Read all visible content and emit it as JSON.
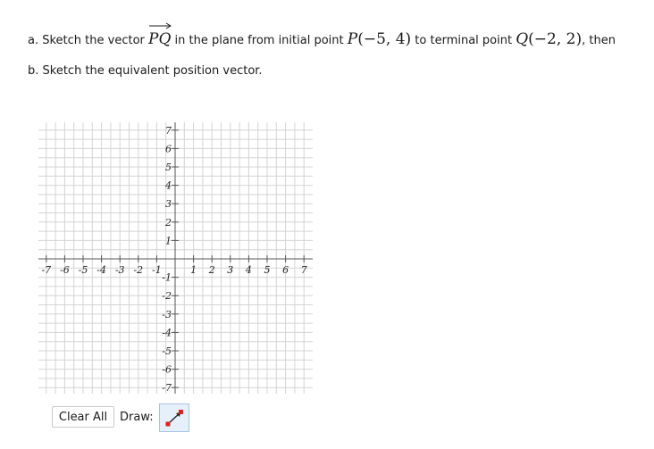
{
  "problem": {
    "part_a": {
      "prefix": "a. Sketch the vector ",
      "vector_from": "P",
      "vector_to": "Q",
      "mid1": " in the plane from initial point ",
      "p_label": "P",
      "p_coords": "(−5, 4)",
      "mid2": " to terminal point ",
      "q_label": "Q",
      "q_coords": "(−2, 2)",
      "suffix": ", then"
    },
    "part_b": "b. Sketch the equivalent position vector."
  },
  "graph": {
    "x_ticks": [
      "-7",
      "-6",
      "-5",
      "-4",
      "-3",
      "-2",
      "-1",
      "1",
      "2",
      "3",
      "4",
      "5",
      "6",
      "7"
    ],
    "y_ticks": [
      "7",
      "6",
      "5",
      "4",
      "3",
      "2",
      "1",
      "-1",
      "-2",
      "-3",
      "-4",
      "-5",
      "-6",
      "-7"
    ],
    "grid_color": "#d4d4d4",
    "axis_color": "#555555"
  },
  "toolbar": {
    "clear_label": "Clear All",
    "draw_label": "Draw:",
    "tool_icon": "vector-arrow-icon"
  }
}
